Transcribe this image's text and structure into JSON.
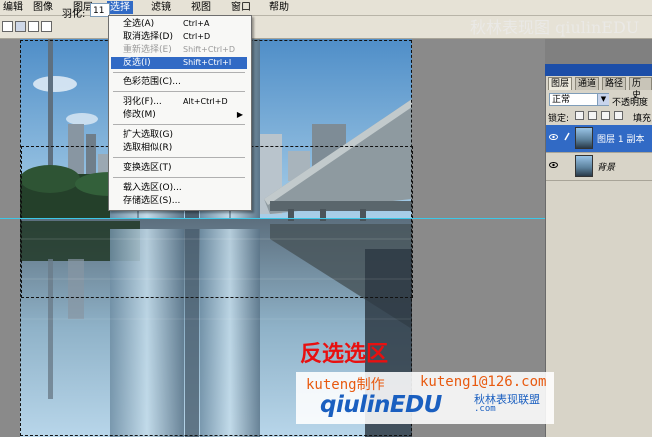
{
  "menubar": {
    "items": [
      "编辑",
      "图像",
      "图层",
      "选择",
      "滤镜",
      "视图",
      "窗口",
      "帮助"
    ],
    "active": "选择"
  },
  "options_bar": {
    "feather_label": "羽化:",
    "feather_value": "11"
  },
  "select_menu": {
    "items": [
      {
        "label": "全选(A)",
        "shortcut": "Ctrl+A"
      },
      {
        "label": "取消选择(D)",
        "shortcut": "Ctrl+D"
      },
      {
        "label": "重新选择(E)",
        "shortcut": "Shift+Ctrl+D",
        "disabled": true
      },
      {
        "label": "反选(I)",
        "shortcut": "Shift+Ctrl+I",
        "highlighted": true
      },
      {
        "label": "色彩范围(C)..."
      },
      {
        "label": "羽化(F)...",
        "shortcut": "Alt+Ctrl+D"
      },
      {
        "label": "修改(M)",
        "submenu": "▶"
      },
      {
        "label": "扩大选取(G)"
      },
      {
        "label": "选取相似(R)"
      },
      {
        "label": "变换选区(T)"
      },
      {
        "label": "载入选区(O)..."
      },
      {
        "label": "存储选区(S)..."
      }
    ]
  },
  "layers_panel": {
    "tabs": [
      "图层",
      "通道",
      "路径",
      "历史"
    ],
    "blend_mode": "正常",
    "dropdown_glyph": "▼",
    "opacity_label": "不透明度",
    "lock_label": "锁定:",
    "fill_label": "填充",
    "layers": [
      {
        "name": "图层 1 副本",
        "selected": true
      },
      {
        "name": "背景",
        "selected": false
      }
    ]
  },
  "overlay": {
    "watermark_top": "秋林表现图 qiulinEDU",
    "caption": "反选选区",
    "credit_author": "kuteng制作",
    "credit_email": "kuteng1@126.com",
    "credit_logo": "qiulinEDU",
    "credit_cn": "秋林表现联盟",
    "credit_url": ".com"
  },
  "colors": {
    "menu_highlight": "#316ac5",
    "guide": "#3cc8e8",
    "caption": "#e81010",
    "credit_orange": "#e85a10",
    "logo_blue": "#1a5fc0"
  }
}
